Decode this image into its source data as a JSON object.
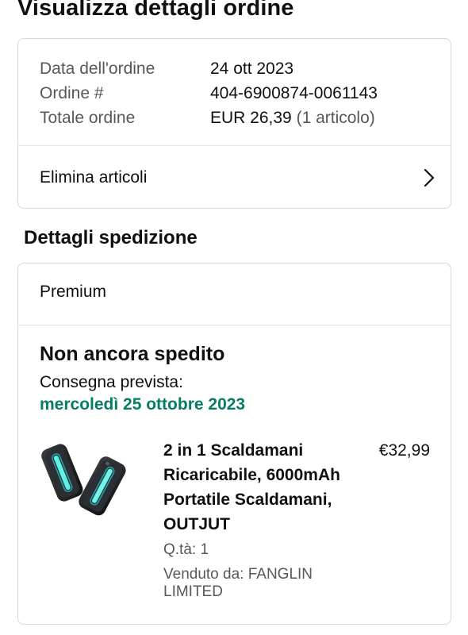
{
  "page": {
    "title": "Visualizza dettagli ordine"
  },
  "summary": {
    "order_date_label": "Data dell'ordine",
    "order_date_value": "24 ott 2023",
    "order_number_label": "Ordine #",
    "order_number_value": "404-6900874-0061143",
    "order_total_label": "Totale ordine",
    "order_total_value": "EUR 26,39",
    "order_total_items": "(1 articolo)",
    "remove_items_label": "Elimina articoli",
    "remove_items_icon": "chevron-right-icon"
  },
  "shipment": {
    "section_title": "Dettagli spedizione",
    "delivery_type": "Premium",
    "status": "Non ancora spedito",
    "eta_label": "Consegna prevista:",
    "eta_date": "mercoledì 25 ottobre 2023",
    "eta_color": "#067d62",
    "item": {
      "name": "2 in 1 Scaldamani Ricaricabile, 6000mAh Portatile Scaldamani, OUTJUT",
      "price": "€32,99",
      "quantity": "Q.tà: 1",
      "seller": "Venduto da: FANGLIN LIMITED",
      "image_icon": "hand-warmer-product-image"
    }
  }
}
